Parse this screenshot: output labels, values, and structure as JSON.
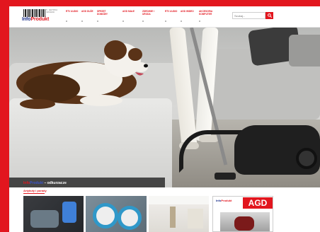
{
  "header": {
    "logo": {
      "brand_part1": "Info",
      "brand_part2": "Produkt",
      "barcode_number": "5 907654 321028"
    },
    "nav": [
      {
        "label": "RTV AUDIO"
      },
      {
        "label": "AGD DUŻE"
      },
      {
        "label": "SPRZĘT DOMOWY"
      },
      {
        "label": "AGD MAŁE"
      },
      {
        "label": "ZDROWIE I URODA"
      },
      {
        "label": "RTV AUDIO"
      },
      {
        "label": "AGD WIDEO"
      },
      {
        "label": "AKCESORIA KOMPUTER"
      }
    ],
    "search": {
      "placeholder": "Szukaj..."
    }
  },
  "hero": {
    "caption_brand1": "Info",
    "caption_brand2": "Produkt",
    "caption_text": " – odkurzacze"
  },
  "articles": {
    "label": "Artykuły i porady",
    "magazine": {
      "logo_part1": "Info",
      "logo_part2": "Produkt",
      "title": "AGD"
    }
  },
  "colors": {
    "brand_red": "#e2161e",
    "brand_blue": "#1a2f8a"
  }
}
